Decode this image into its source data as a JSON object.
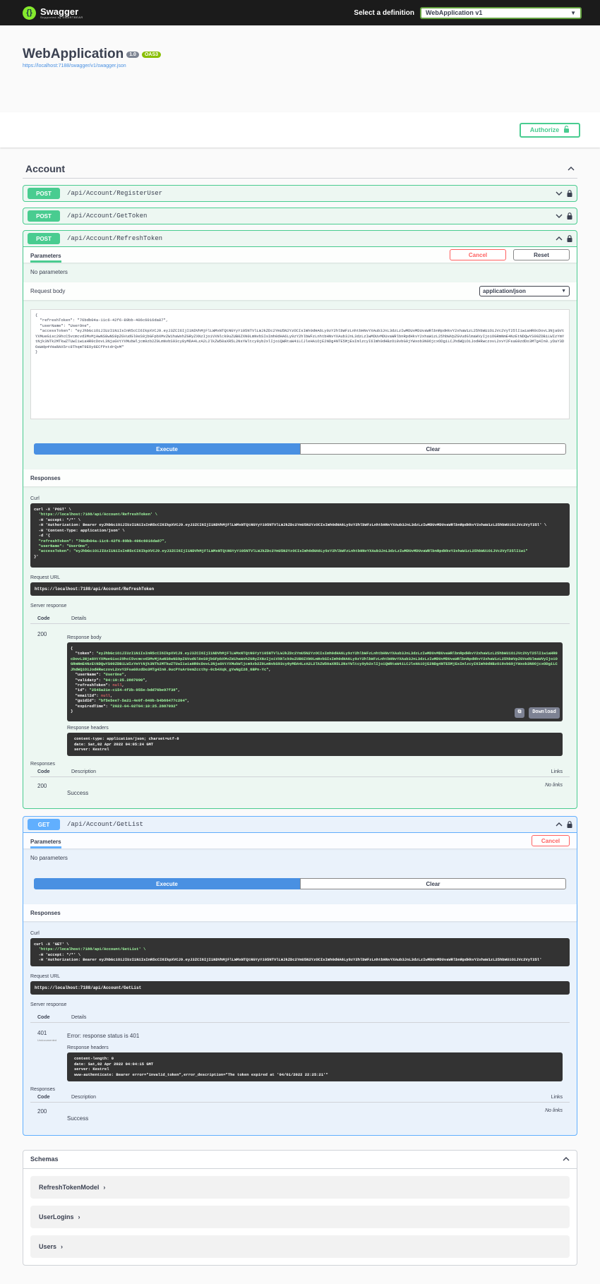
{
  "topbar": {
    "logo_title": "Swagger",
    "logo_sub": "Supported by SMARTBEAR",
    "select_label": "Select a definition",
    "select_value": "WebApplication v1"
  },
  "info": {
    "title": "WebApplication",
    "version": "1.0",
    "oas": "OAS3",
    "url": "https://localhost:7188/swagger/v1/swagger.json"
  },
  "authorize_label": "Authorize",
  "section": {
    "title": "Account"
  },
  "operations": {
    "register": {
      "method": "POST",
      "path": "/api/Account/RegisterUser"
    },
    "gettoken": {
      "method": "POST",
      "path": "/api/Account/GetToken"
    },
    "refresh": {
      "method": "POST",
      "path": "/api/Account/RefreshToken",
      "tab": "Parameters",
      "cancel": "Cancel",
      "reset": "Reset",
      "no_params": "No parameters",
      "request_body_label": "Request body",
      "content_type": "application/json",
      "request_body": "{\n  \"refreshToken\": \"76bdb04a-11c6-42f6-89bb-406c6016da87\",\n  \"userName\": \"UserOne\",\n  \"accessToken\": \"eyJhbGciOiJIUzI1NiIsInR5cCI6IkpXVCJ9.eyJ3ZCI6IjI1NDVhMjFlLWMxNTQtNGYyYi05NTVlLWJkZDc2YmU5N2YzOCIsImh0dHA6Ly9zY2hlbWFzLnhtbHNvYXAub3JnL3dzLzIwMDUvMDUvaWRlbnRpdHkvY2xhaW1zL25hbWUiOiJVc2VyT25lIiwiaHR0cDovL3NjaGVtYXMueG1sc29hcC5vcmcvd3MvMjAwNS8wNS9pZGVudGl0eS9jbGFpbXMvZW1haWxhZGRyZXNzIjoiVXNlck9uZUB0ZXN0LmNvbSIsImh0dHA6Ly9zY2hlbWFzLnhtbHNvYXAub3JnL3dzLzIwMDUvMDUvaWRlbnRpdHkvY2xhaW1zL25hbWVpZGVudGlmaWVyIjoiOGRmNmE4NzEtNDQwYS00ZDBiLWIzYmYtNjk3NTk2MTkwZTUwIiwiaHR0cDovL3NjaGVtYXMubWljcm9zb2Z0LmNvbS93cy8yMDA4LzA2L2lkZW50aXR5L2NsYWltcy9yb2xlIjoiQWRtaW4iLCJleHAiOjE2NDg4NTE5MjEsImlzcyI6Imh0dHBzOi8vbG9jYWxob3N0OjcxODgiLCJhdWQiOiJodHRwczovL2xvY2FsaG9zdDo3MTg4In0.yDaY3DOaWdp4YHaRAX5rc8ThqmT9EOy6ECfPxtdrQvM\"\n}",
      "execute": "Execute",
      "clear": "Clear",
      "responses_label": "Responses",
      "curl_label": "Curl",
      "curl_lines": [
        "curl -X 'POST' \\",
        "  'https://localhost:7188/api/Account/RefreshToken' \\",
        "  -H 'accept: */*' \\",
        "  -H 'Authorization: Bearer eyJhbGciOiJIUzI1NiIsInR5cCI6IkpXVCJ9.eyJ3ZCI6IjI1NDVhMjFlLWMxNTQtNGYyYi05NTVlLWJkZDc2YmU5N2YzOCIsImh0dHA6Ly9zY2hlbWFzLnhtbHNvYXAub3JnL3dzLzIwMDUvMDUvaWRlbnRpdHkvY2xhaW1zL25hbWUiOiJVc2VyT25l' \\",
        "  -H 'Content-Type: application/json' \\",
        "  -d '{",
        "  \"refreshToken\": \"76bdb04a-11c6-42f6-89bb-406c6016da87\",",
        "  \"userName\": \"UserOne\",",
        "  \"accessToken\": \"eyJhbGciOiJIUzI1NiIsInR5cCI6IkpXVCJ9.eyJ3ZCI6IjI1NDVhMjFlLWMxNTQtNGYyYi05NTVlLWJkZDc2YmU5N2YzOCIsImh0dHA6Ly9zY2hlbWFzLnhtbHNvYXAub3JnL3dzLzIwMDUvMDUvaWRlbnRpdHkvY2xhaW1zL25hbWUiOiJVc2VyT25lIiwi\"",
        "}'"
      ],
      "request_url_label": "Request URL",
      "request_url": "https://localhost:7188/api/Account/RefreshToken",
      "server_response_label": "Server response",
      "code_col": "Code",
      "details_col": "Details",
      "status_code": "200",
      "response_body_label": "Response body",
      "response_body": {
        "token_key": "\"token\": ",
        "token": "\"eyJhbGciOiJIUzI1NiIsInR5cCI6IkpXVCJ9.eyJ3ZCI6IjI1NDVhMjFlLWMxNTQtNGYyYi05NTVlLWJkZDc2YmU5N2YzOCIsImh0dHA6Ly9zY2hlbWFzLnhtbHNvYXAub3JnL3dzLzIwMDUvMDUvaWRlbnRpdHkvY2xhaW1zL25hbWUiOiJVc2VyT25lIiwiaHR0cDovL3NjaGVtYXMueG1sc29hcC5vcmcvd3MvMjAwNS8wNS9pZGVudGl0eS9jbGFpbXMvZW1haWxhZGRyZXNzIjoiVXNlck9uZUB0ZXN0LmNvbSIsImh0dHA6Ly9zY2hlbWFzLnhtbHNvYXAub3JnL3dzLzIwMDUvMDUvaWRlbnRpdHkvY2xhaW1zL25hbWVpZGVudGlmaWVyIjoiOGRmNmE4NzEtNDQwYS00ZDBiLWIzYmYtNjk3NTk2MTkwZTUwIiwiaHR0cDovL3NjaGVtYXMubWljcm9zb2Z0LmNvbS93cy8yMDA4LzA2L2lkZW50aXR5L2NsYWltcy9yb2xlIjoiQWRtaW4iLCJleHAiOjE2NDg4NTE5MjEsImlzcyI6Imh0dHBzOi8vbG9jYWxob3N0OjcxODgiLCJhdWQiOiJodHRwczovL2xvY2FsaG9zdDo3MTg4In0.0ucPYuArUemZccthy-0cb4Xqk_gYwNgI28_6BPn-Yc\"",
        "username_key": "\"userName\": ",
        "username": "\"UserOne\"",
        "validaty_key": "\"validaty\": ",
        "validaty": "\"04:10:25.2887090\"",
        "refresh_key": "\"refreshToken\": ",
        "refresh": "null",
        "id_key": "\"id\": ",
        "id": "\"2545a21e-c154-4f2b-955e-bdd76be97f38\"",
        "emailid_key": "\"emailId\": ",
        "emailid": "null",
        "guid_key": "\"guidId\": ",
        "guid": "\"bf5e5ee7-5a21-4e0f-840b-b4b66477c204\"",
        "expired_key": "\"expiredTime\": ",
        "expired": "\"2022-04-02T04:10:25.2887092\""
      },
      "download": "Download",
      "response_headers_label": "Response headers",
      "response_headers": [
        "content-type: application/json; charset=utf-8",
        "date: Sat,02 Apr 2022 04:05:24 GMT",
        "server: Kestrel"
      ],
      "responses_label2": "Responses",
      "description_col": "Description",
      "links_col": "Links",
      "doc_code": "200",
      "doc_desc": "Success",
      "doc_links": "No links"
    },
    "getlist": {
      "method": "GET",
      "path": "/api/Account/GetList",
      "tab": "Parameters",
      "cancel": "Cancel",
      "no_params": "No parameters",
      "execute": "Execute",
      "clear": "Clear",
      "responses_label": "Responses",
      "curl_label": "Curl",
      "curl_lines": [
        "curl -X 'GET' \\",
        "  'https://localhost:7188/api/Account/GetList' \\",
        "  -H 'accept: */*' \\",
        "  -H 'Authorization: Bearer eyJhbGciOiJIUzI1NiIsInR5cCI6IkpXVCJ9.eyJ3ZCI6IjI1NDVhMjFlLWMxNTQtNGYyYi05NTVlLWJkZDc2YmU5N2YzOCIsImh0dHA6Ly9zY2hlbWFzLnhtbHNvYXAub3JnL3dzLzIwMDUvMDUvaWRlbnRpdHkvY2xhaW1zL25hbWUiOiJVc2VyT25l'"
      ],
      "request_url_label": "Request URL",
      "request_url": "https://localhost:7188/api/Account/GetList",
      "server_response_label": "Server response",
      "code_col": "Code",
      "details_col": "Details",
      "status_code": "401",
      "status_sub": "Undocumented",
      "error_text": "Error: response status is 401",
      "response_headers_label": "Response headers",
      "response_headers": [
        "content-length: 0",
        "date: Sat,02 Apr 2022 04:04:15 GMT",
        "server: Kestrel",
        "www-authenticate: Bearer error=\"invalid_token\",error_description=\"The token expired at '04/01/2022 22:25:21'\""
      ],
      "responses_label2": "Responses",
      "description_col": "Description",
      "links_col": "Links",
      "doc_code": "200",
      "doc_desc": "Success",
      "doc_links": "No links"
    }
  },
  "schemas": {
    "title": "Schemas",
    "items": [
      "RefreshTokenModel",
      "UserLogins",
      "Users"
    ]
  },
  "colors": {
    "post": "#49cc90",
    "get": "#61affe",
    "execute": "#4990e2",
    "cancel": "#ff6060"
  }
}
